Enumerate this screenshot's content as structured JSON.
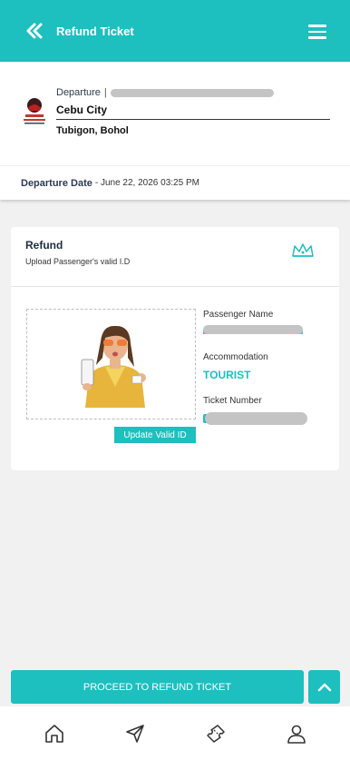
{
  "header": {
    "title": "Refund Ticket"
  },
  "route": {
    "departure_label": "Departure",
    "separator": "|",
    "origin": "Cebu City",
    "destination": "Tubigon, Bohol"
  },
  "departure_date": {
    "label": "Departure Date",
    "value": "- June 22, 2026 03:25 PM"
  },
  "refund_card": {
    "title": "Refund",
    "subtitle": "Upload Passenger's valid I.D",
    "update_button": "Update Valid ID",
    "passenger_name_label": "Passenger Name",
    "accommodation_label": "Accommodation",
    "accommodation_value": "TOURIST",
    "ticket_number_label": "Ticket Number"
  },
  "actions": {
    "proceed": "PROCEED TO REFUND TICKET"
  },
  "colors": {
    "accent": "#1dbfbf",
    "redaction": "#c4c4c4"
  },
  "icons": {
    "back": "double-chevron-left-icon",
    "menu": "hamburger-icon",
    "crown": "crown-icon",
    "up": "chevron-up-icon",
    "nav": [
      "home-icon",
      "send-icon",
      "ticket-icon",
      "user-icon"
    ]
  }
}
